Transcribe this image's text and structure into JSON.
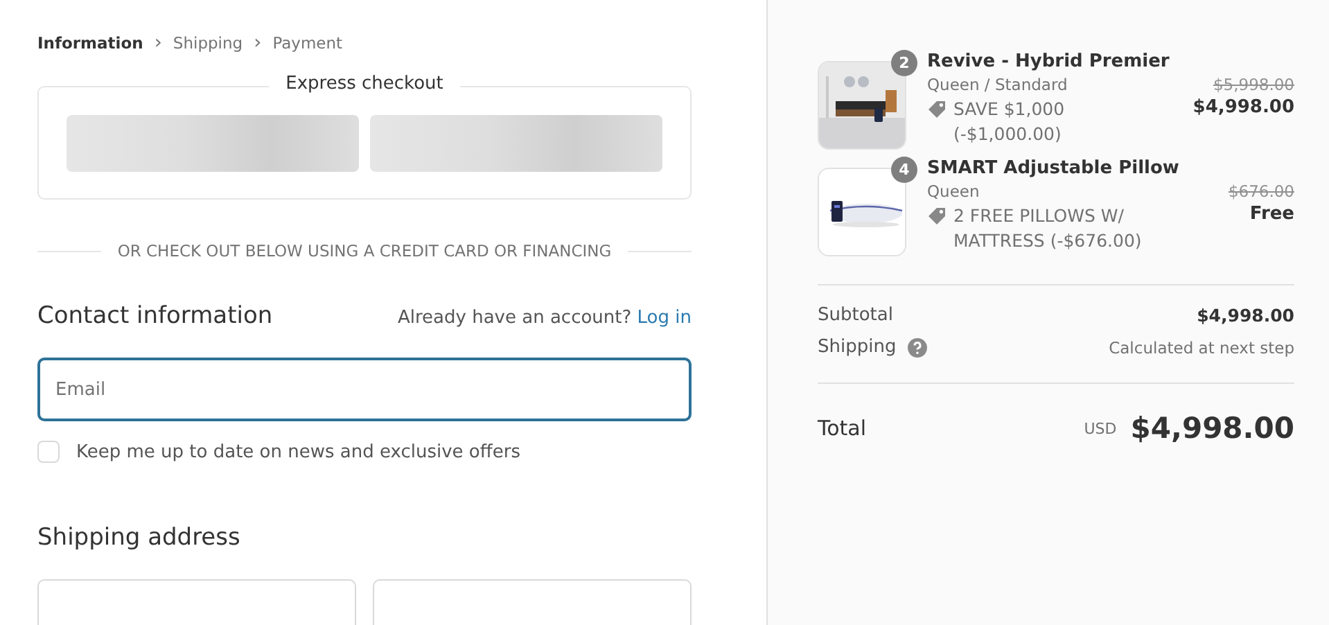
{
  "breadcrumb": [
    {
      "label": "Information",
      "selected": true
    },
    {
      "label": "Shipping",
      "selected": false
    },
    {
      "label": "Payment",
      "selected": false
    }
  ],
  "breadcrumb_separator": "›",
  "express_checkout": {
    "title": "Express checkout",
    "buttons": [
      {
        "kind": "placeholder"
      },
      {
        "kind": "placeholder"
      }
    ]
  },
  "divider_text": "OR CHECK OUT BELOW USING A CREDIT CARD OR FINANCING",
  "contact": {
    "heading": "Contact information",
    "account_prompt": "Already have an account?",
    "login_link": "Log in",
    "email": {
      "placeholder": "Email",
      "focused": true
    },
    "newsletter": {
      "label": "Keep me up to date on news and exclusive offers",
      "checked": false
    }
  },
  "shipping_address": {
    "heading": "Shipping address",
    "fields": [
      {
        "kind": "input"
      },
      {
        "kind": "input"
      }
    ]
  },
  "order_items": [
    {
      "quantity": "2",
      "name": "Revive - Hybrid Premier",
      "variant": "Queen / Standard",
      "discount": "SAVE $1,000 (-$1,000.00)",
      "original_price": "$5,998.00",
      "price": "$4,998.00"
    },
    {
      "quantity": "4",
      "name": "SMART Adjustable Pillow",
      "variant": "Queen",
      "discount": "2 FREE PILLOWS W/ MATTRESS (-$676.00)",
      "original_price": "$676.00",
      "price": "Free"
    }
  ],
  "subtotal": {
    "label": "Subtotal",
    "value": "$4,998.00"
  },
  "shipping": {
    "label": "Shipping",
    "value": "Calculated at next step"
  },
  "total": {
    "label": "Total",
    "currency": "USD",
    "value": "$4,998.00"
  }
}
